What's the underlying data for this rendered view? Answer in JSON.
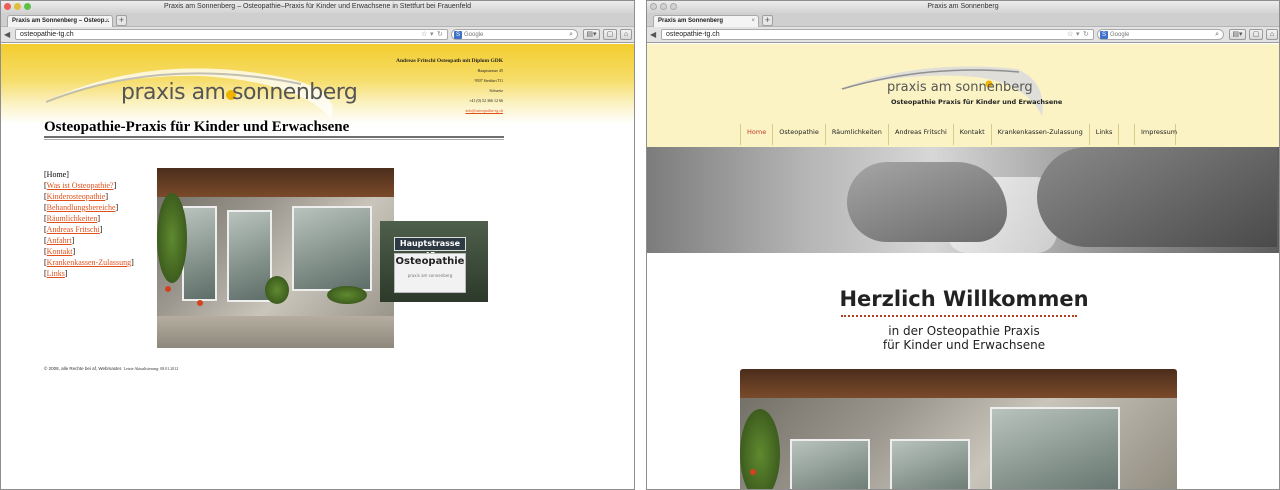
{
  "left": {
    "window_title": "Praxis am Sonnenberg – Osteopathie–Praxis für Kinder und Erwachsene in Stettfurt bei Frauenfeld",
    "tab_label": "Praxis am Sonnenberg – Osteop...",
    "url": "osteopathie-tg.ch",
    "search_placeholder": "Google",
    "logo_text": "praxis am sonnenberg",
    "contact": {
      "name": "Andreas Fritschi Osteopath mit Diplom GDK",
      "street": "Hauptstrasse 45",
      "city": "9507 Stettfurt TG",
      "country": "Schweiz",
      "phone": "+41 (0) 52 366 12 66",
      "email": "info@osteopathie-tg.ch"
    },
    "title": "Osteopathie-Praxis für Kinder und Erwachsene",
    "nav_home": "Home",
    "nav_links": [
      "Was ist Osteopathie?",
      "Kinderosteopathie",
      "Behandlungsbereiche",
      "Räumlichkeiten",
      "Andreas Fritschi",
      "Anfahrt",
      "Kontakt",
      "Krankenkassen-Zulassung",
      "Links"
    ],
    "sign_street": "Hauptstrasse 45",
    "sign_main": "Osteopathie",
    "sign_small": "praxis am sonnenberg",
    "footer": "© 2008, alle Rechte bei af, Webmaster.",
    "footer_updated": "Letzte Aktualisierung: 08.01.2012"
  },
  "right": {
    "window_title": "Praxis am Sonnenberg",
    "tab_label": "Praxis am Sonnenberg",
    "url": "osteopathie-tg.ch",
    "search_placeholder": "Google",
    "logo_text": "praxis am sonnenberg",
    "subtitle": "Osteopathie Praxis für Kinder und Erwachsene",
    "nav": [
      "Home",
      "Osteopathie",
      "Räumlichkeiten",
      "Andreas Fritschi",
      "Kontakt",
      "Krankenkassen-Zulassung",
      "Links"
    ],
    "nav_impressum": "Impressum",
    "welcome": "Herzlich Willkommen",
    "line1": "in der Osteopathie Praxis",
    "line2": "für Kinder und Erwachsene"
  },
  "colors": {
    "link": "#e0501b",
    "accent_red": "#c0392b",
    "header_yellow": "#f3cd2e",
    "header_cream": "#fbf3c4"
  }
}
